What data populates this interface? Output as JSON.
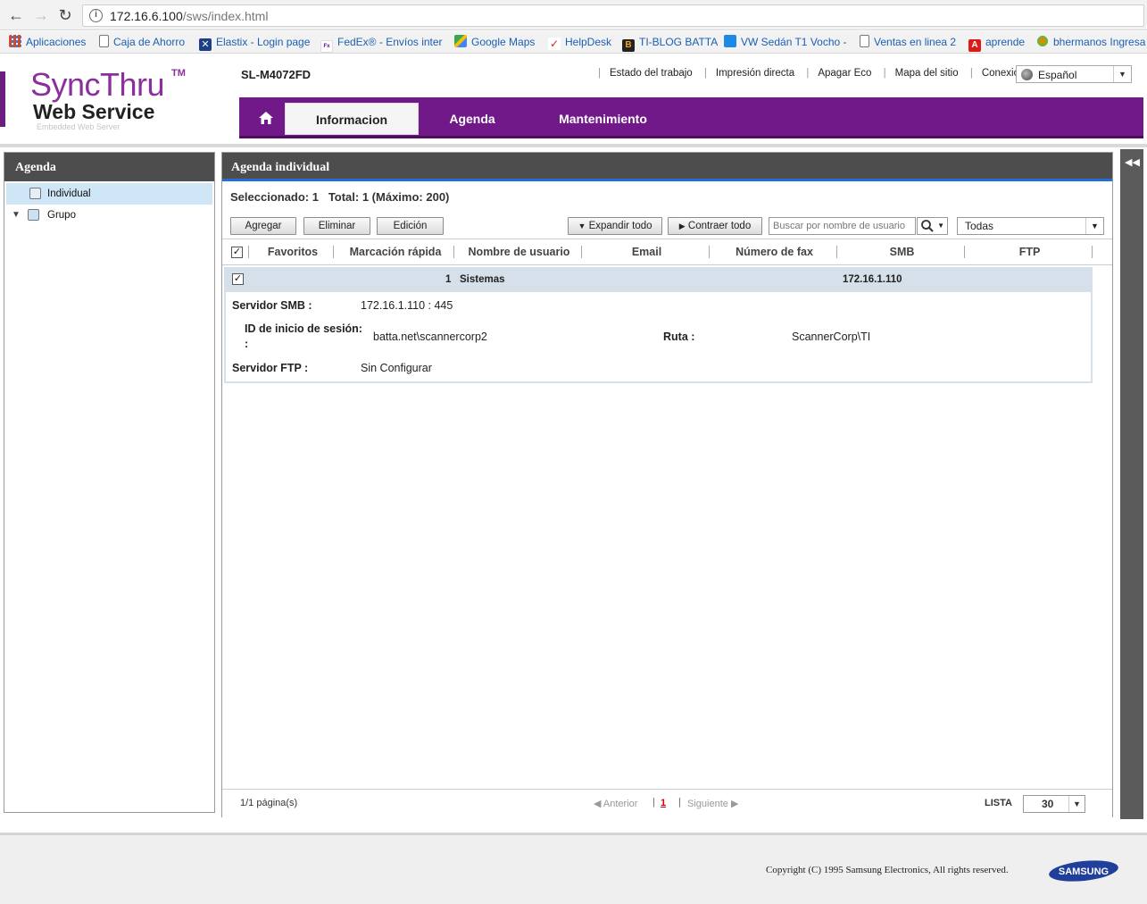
{
  "browser": {
    "url_host": "172.16.6.100",
    "url_path": "/sws/index.html",
    "bookmarks": [
      {
        "label": "Aplicaciones",
        "icon": "apps-grid-icon",
        "color": "#d04a2f"
      },
      {
        "label": "Caja de Ahorro",
        "icon": "page-icon",
        "color": "#ffffff"
      },
      {
        "label": "Elastix - Login page",
        "icon": "elastix-icon",
        "color": "#1d3f8a"
      },
      {
        "label": "FedEx® - Envíos inter",
        "icon": "fedex-icon",
        "color": "#4d148c"
      },
      {
        "label": "Google Maps",
        "icon": "maps-icon",
        "color": "#34a853"
      },
      {
        "label": "HelpDesk",
        "icon": "helpdesk-icon",
        "color": "#c62828"
      },
      {
        "label": "TI-BLOG BATTA",
        "icon": "blogger-icon",
        "color": "#222222"
      },
      {
        "label": "VW Sedán T1 Vocho -",
        "icon": "vw-icon",
        "color": "#1e88e5"
      },
      {
        "label": "Ventas en linea 2",
        "icon": "page-icon",
        "color": "#ffffff"
      },
      {
        "label": "aprende",
        "icon": "angular-icon",
        "color": "#dd1b16"
      },
      {
        "label": "bhermanos Ingresa",
        "icon": "gear-flower-icon",
        "color": "#e08a00"
      }
    ]
  },
  "header": {
    "logo_sync": "SyncThru",
    "logo_tm": "TM",
    "logo_web": "Web Service",
    "logo_embedded": "Embedded Web Server",
    "model": "SL-M4072FD",
    "top_links": [
      "Estado del trabajo",
      "Impresión directa",
      "Apagar Eco",
      "Mapa del sitio",
      "Conexión"
    ],
    "language": "Español",
    "tabs": [
      "Informacion",
      "Agenda",
      "Mantenimiento"
    ]
  },
  "sidebar": {
    "title": "Agenda",
    "items": [
      "Individual",
      "Grupo"
    ]
  },
  "main": {
    "title": "Agenda individual",
    "summary": "Seleccionado: 1   Total: 1 (Máximo: 200)",
    "buttons": {
      "add": "Agregar",
      "delete": "Eliminar",
      "edit": "Edición",
      "expand_all": "Expandir todo",
      "collapse_all": "Contraer todo"
    },
    "search_placeholder": "Buscar por nombre de usuario",
    "filter": "Todas",
    "columns": [
      "Favoritos",
      "Marcación rápida",
      "Nombre de usuario",
      "Email",
      "Número de fax",
      "SMB",
      "FTP"
    ],
    "rows": [
      {
        "checked": true,
        "speed_dial": "1",
        "name": "Sistemas",
        "email": "",
        "fax": "",
        "smb": "172.16.1.110",
        "ftp": ""
      }
    ],
    "detail": {
      "smb_server_label": "Servidor SMB :",
      "smb_server_value": "172.16.1.110 : 445",
      "login_id_label": "ID de inicio de sesión:",
      "login_id_label_cont": ":",
      "login_id_value": "batta.net\\scannercorp2",
      "path_label": "Ruta :",
      "path_value": "ScannerCorp\\TI",
      "ftp_server_label": "Servidor FTP :",
      "ftp_server_value": "Sin Configurar"
    },
    "pager": {
      "pages": "1/1 página(s)",
      "prev": "Anterior",
      "current": "1",
      "next": "Siguiente",
      "list_label": "LISTA",
      "list_size": "30"
    }
  },
  "footer": {
    "copyright": "Copyright (C) 1995 Samsung Electronics, All rights reserved.",
    "brand": "SAMSUNG"
  },
  "colors": {
    "brand_purple": "#72198a",
    "panel_header": "#4d4d4d",
    "accent_blue": "#1f6fd6",
    "row_highlight": "#d5e0ea"
  }
}
